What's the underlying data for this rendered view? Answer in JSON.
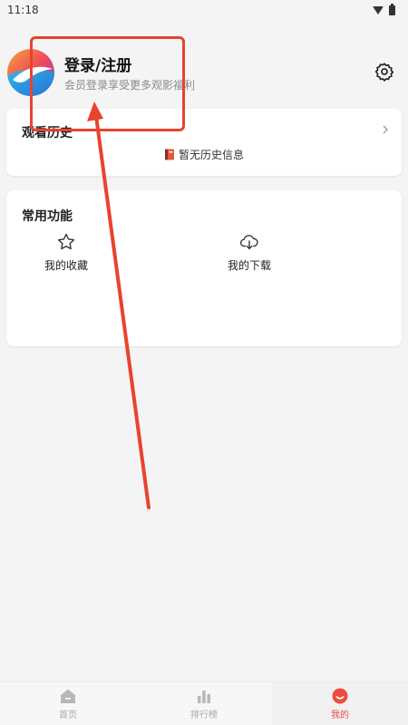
{
  "status_bar": {
    "time": "11:18"
  },
  "header": {
    "title": "登录/注册",
    "subtitle": "会员登录享受更多观影福利"
  },
  "history": {
    "title": "观看历史",
    "empty_text": "暂无历史信息"
  },
  "functions": {
    "title": "常用功能",
    "items": [
      {
        "label": "我的收藏",
        "icon": "star-icon"
      },
      {
        "label": "我的下载",
        "icon": "cloud-download-icon"
      }
    ]
  },
  "tabbar": {
    "items": [
      {
        "label": "首页",
        "icon": "home-icon",
        "active": false
      },
      {
        "label": "排行榜",
        "icon": "bar-chart-icon",
        "active": false
      },
      {
        "label": "我的",
        "icon": "smile-icon",
        "active": true
      }
    ]
  },
  "colors": {
    "accent": "#ee4b3f",
    "annotation": "#e8432e",
    "background": "#f4f4f4"
  }
}
